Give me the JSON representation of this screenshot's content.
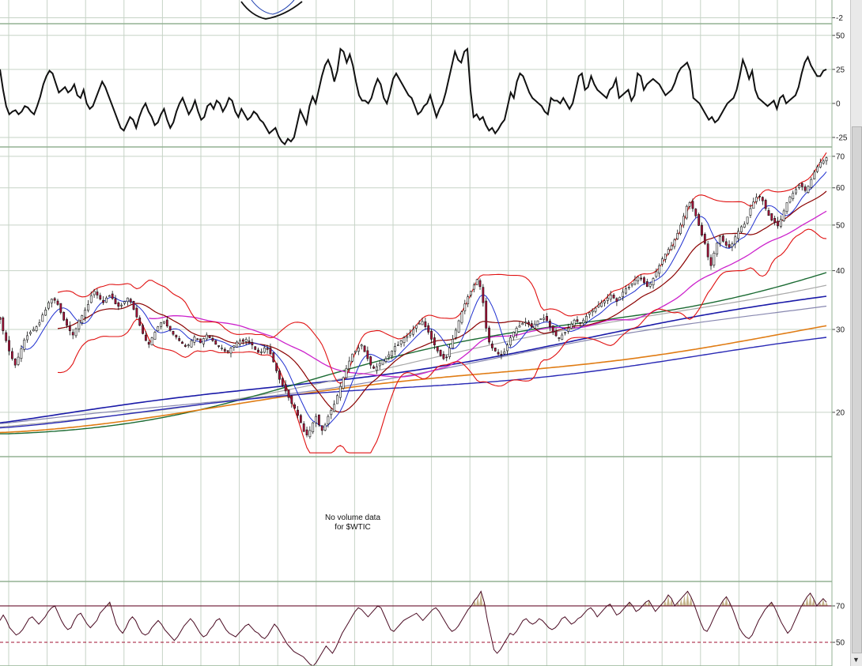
{
  "chart_data": [
    {
      "type": "line",
      "panel": "top-indicator-fragment",
      "y_tick_labels": [
        "-2"
      ],
      "ylim": [
        -3,
        1
      ],
      "grid": true
    },
    {
      "type": "line",
      "panel": "momentum-oscillator",
      "y_tick_labels": [
        "50",
        "25",
        "0",
        "-25"
      ],
      "ylim": [
        -32,
        58
      ],
      "grid": true,
      "series": [
        {
          "values": [
            25,
            10,
            -2,
            -8,
            -6,
            -5,
            -8,
            -6,
            -2,
            -3,
            -6,
            -8,
            -2,
            5,
            14,
            20,
            24,
            22,
            15,
            8,
            10,
            12,
            8,
            10,
            14,
            6,
            4,
            10,
            0,
            -4,
            -2,
            4,
            10,
            16,
            12,
            6,
            0,
            -6,
            -12,
            -18,
            -20,
            -15,
            -10,
            -12,
            -18,
            -10,
            -4,
            0,
            -6,
            -10,
            -16,
            -14,
            -8,
            -4,
            -12,
            -18,
            -14,
            -6,
            0,
            4,
            -2,
            -8,
            -4,
            2,
            -6,
            -12,
            -10,
            -2,
            0,
            -4,
            2,
            0,
            -6,
            -2,
            4,
            2,
            -6,
            -10,
            -4,
            -8,
            -12,
            -10,
            -6,
            -8,
            -12,
            -14,
            -18,
            -22,
            -20,
            -18,
            -24,
            -28,
            -30,
            -26,
            -28,
            -25,
            -15,
            -5,
            -10,
            -15,
            -2,
            5,
            0,
            10,
            20,
            28,
            32,
            26,
            16,
            24,
            40,
            38,
            30,
            36,
            28,
            16,
            6,
            2,
            2,
            0,
            4,
            12,
            18,
            14,
            4,
            0,
            8,
            18,
            22,
            18,
            14,
            10,
            6,
            4,
            -2,
            -8,
            -6,
            -2,
            0,
            6,
            -2,
            -10,
            -4,
            0,
            8,
            18,
            28,
            38,
            32,
            30,
            38,
            40,
            10,
            -10,
            -8,
            -12,
            -10,
            -16,
            -20,
            -18,
            -22,
            -19,
            -15,
            -12,
            -2,
            8,
            4,
            16,
            22,
            20,
            14,
            8,
            4,
            2,
            0,
            -2,
            -6,
            -8,
            4,
            2,
            2,
            0,
            4,
            0,
            -4,
            0,
            10,
            20,
            22,
            10,
            12,
            20,
            14,
            10,
            8,
            6,
            4,
            10,
            12,
            18,
            4,
            6,
            8,
            10,
            2,
            6,
            22,
            20,
            10,
            14,
            16,
            18,
            16,
            14,
            10,
            6,
            8,
            10,
            15,
            22,
            26,
            28,
            30,
            24,
            4,
            2,
            0,
            -4,
            -8,
            -12,
            -10,
            -14,
            -12,
            -8,
            -4,
            0,
            2,
            4,
            10,
            20,
            32,
            26,
            18,
            24,
            10,
            4,
            2,
            0,
            -2,
            0,
            2,
            -4,
            4,
            6,
            0,
            2,
            4,
            6,
            12,
            22,
            30,
            34,
            28,
            24,
            20,
            20,
            24,
            25
          ]
        }
      ]
    },
    {
      "type": "line",
      "panel": "price",
      "subtype": "candlestick with Bollinger Bands and moving averages",
      "y_scale": "log",
      "y_tick_labels": [
        "70",
        "60",
        "50",
        "40",
        "30",
        "20"
      ],
      "ylim": [
        16.1,
        73
      ],
      "grid": true,
      "series": [
        {
          "kind": "close",
          "values": [
            31.5,
            29.8,
            28.4,
            27.0,
            26.0,
            25.2,
            26.2,
            27.3,
            28.5,
            29.1,
            29.6,
            30.0,
            30.4,
            31.0,
            32.2,
            33.0,
            34.2,
            34.8,
            34.6,
            33.9,
            32.6,
            31.4,
            30.6,
            29.8,
            29.2,
            30.1,
            31.3,
            32.1,
            33.0,
            33.9,
            35.4,
            36.2,
            35.5,
            34.8,
            34.2,
            35.0,
            35.4,
            34.9,
            34.0,
            33.6,
            33.8,
            34.4,
            35.0,
            34.3,
            33.1,
            31.9,
            30.6,
            29.4,
            28.4,
            27.9,
            28.8,
            29.6,
            30.4,
            31.0,
            31.2,
            30.5,
            29.9,
            29.3,
            28.9,
            28.4,
            28.0,
            27.6,
            27.8,
            28.4,
            28.9,
            28.6,
            28.1,
            28.7,
            29.2,
            28.8,
            28.4,
            27.9,
            27.6,
            27.4,
            27.0,
            26.9,
            27.4,
            27.7,
            28.2,
            28.4,
            28.3,
            28.6,
            28.3,
            27.8,
            27.2,
            26.8,
            26.9,
            27.4,
            27.2,
            26.6,
            25.6,
            24.5,
            23.5,
            22.8,
            22.2,
            21.5,
            20.9,
            20.4,
            19.7,
            19.0,
            18.2,
            17.9,
            18.3,
            19.0,
            19.6,
            18.8,
            18.3,
            18.8,
            19.6,
            20.2,
            20.8,
            21.7,
            22.7,
            23.7,
            24.8,
            25.7,
            26.6,
            27.0,
            27.4,
            27.8,
            26.9,
            26.0,
            25.2,
            24.8,
            25.0,
            25.4,
            25.8,
            26.0,
            26.5,
            27.0,
            27.6,
            27.8,
            28.4,
            28.8,
            29.0,
            29.5,
            30.0,
            30.6,
            30.9,
            31.2,
            30.4,
            29.6,
            28.6,
            27.8,
            27.0,
            26.4,
            26.0,
            26.2,
            27.4,
            28.6,
            29.9,
            31.3,
            32.7,
            34.0,
            35.2,
            36.2,
            37.3,
            38.3,
            37.0,
            34.2,
            30.2,
            28.2,
            27.4,
            27.0,
            26.6,
            26.5,
            26.9,
            27.8,
            28.8,
            29.6,
            30.2,
            30.5,
            30.9,
            31.1,
            30.8,
            30.4,
            30.8,
            31.3,
            31.6,
            31.7,
            31.3,
            30.4,
            29.6,
            29.1,
            28.8,
            29.2,
            29.6,
            30.2,
            30.8,
            31.4,
            31.2,
            30.9,
            31.4,
            32.0,
            32.6,
            32.9,
            33.3,
            33.8,
            34.2,
            34.5,
            35.0,
            35.5,
            35.0,
            34.4,
            35.1,
            36.0,
            36.6,
            36.9,
            37.5,
            38.2,
            38.8,
            38.4,
            37.7,
            37.0,
            37.5,
            38.5,
            39.8,
            41.0,
            42.4,
            43.4,
            44.4,
            45.2,
            46.5,
            48.0,
            50.0,
            52.2,
            54.8,
            55.8,
            54.2,
            52.3,
            49.9,
            47.6,
            45.7,
            42.8,
            41.0,
            43.6,
            45.8,
            47.3,
            46.2,
            45.3,
            44.8,
            45.6,
            47.2,
            48.5,
            49.6,
            50.2,
            52.0,
            54.2,
            56.0,
            57.3,
            57.5,
            56.3,
            54.2,
            52.4,
            51.2,
            50.6,
            49.8,
            51.4,
            53.6,
            55.8,
            57.4,
            58.4,
            59.5,
            60.8,
            60.3,
            59.2,
            60.4,
            62.5,
            64.8,
            66.5,
            68.0,
            68.4,
            69.5
          ]
        },
        {
          "kind": "bollinger-upper"
        },
        {
          "kind": "bollinger-lower"
        },
        {
          "kind": "moving-average"
        },
        {
          "kind": "moving-average"
        },
        {
          "kind": "moving-average"
        },
        {
          "kind": "moving-average"
        },
        {
          "kind": "moving-average"
        },
        {
          "kind": "moving-average"
        },
        {
          "kind": "moving-average"
        },
        {
          "kind": "moving-average"
        },
        {
          "kind": "moving-average"
        }
      ]
    },
    {
      "type": "bar",
      "panel": "volume",
      "annotation": [
        "No volume data",
        "for $WTIC"
      ]
    },
    {
      "type": "line",
      "panel": "rsi",
      "y_tick_labels": [
        "70",
        "50"
      ],
      "ylim": [
        37,
        83
      ],
      "grid": true,
      "series": [
        {
          "values": [
            62,
            65,
            62,
            58,
            56,
            54,
            55,
            57,
            60,
            63,
            64,
            62,
            60,
            62,
            64,
            67,
            69,
            70,
            66,
            62,
            59,
            57,
            58,
            62,
            65,
            66,
            63,
            60,
            58,
            60,
            62,
            66,
            68,
            70,
            72,
            66,
            60,
            57,
            55,
            58,
            62,
            64,
            62,
            58,
            55,
            54,
            55,
            58,
            60,
            62,
            60,
            57,
            55,
            53,
            51,
            53,
            56,
            59,
            61,
            63,
            61,
            58,
            55,
            53,
            54,
            57,
            59,
            62,
            63,
            60,
            57,
            55,
            54,
            53,
            55,
            57,
            59,
            60,
            58,
            56,
            55,
            53,
            52,
            54,
            57,
            60,
            58,
            55,
            52,
            49,
            47,
            45,
            44,
            43,
            42,
            40,
            38,
            37,
            39,
            42,
            45,
            48,
            46,
            44,
            47,
            51,
            55,
            58,
            61,
            64,
            67,
            69,
            68,
            66,
            64,
            66,
            68,
            70,
            69,
            65,
            61,
            57,
            56,
            58,
            60,
            62,
            63,
            64,
            65,
            66,
            64,
            62,
            64,
            66,
            68,
            69,
            67,
            64,
            61,
            58,
            56,
            57,
            59,
            62,
            65,
            68,
            70,
            73,
            75,
            78,
            72,
            62,
            54,
            46,
            44,
            46,
            49,
            52,
            55,
            54,
            56,
            59,
            62,
            63,
            61,
            60,
            61,
            63,
            62,
            60,
            58,
            57,
            58,
            60,
            63,
            64,
            62,
            60,
            61,
            63,
            64,
            66,
            68,
            69,
            67,
            64,
            66,
            68,
            70,
            71,
            68,
            65,
            66,
            68,
            70,
            72,
            70,
            67,
            68,
            70,
            72,
            73,
            70,
            67,
            69,
            71,
            73,
            76,
            74,
            70,
            72,
            74,
            76,
            78,
            75,
            71,
            66,
            61,
            57,
            56,
            59,
            63,
            67,
            70,
            73,
            75,
            72,
            68,
            63,
            58,
            55,
            53,
            52,
            54,
            58,
            62,
            65,
            68,
            70,
            72,
            69,
            65,
            61,
            58,
            55,
            57,
            61,
            65,
            69,
            72,
            75,
            77,
            74,
            70,
            72,
            74,
            72
          ]
        }
      ]
    }
  ]
}
